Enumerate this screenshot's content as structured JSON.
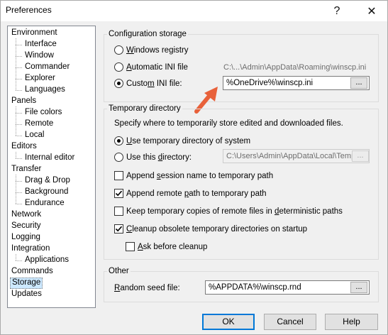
{
  "window": {
    "title": "Preferences",
    "help_glyph": "?",
    "close_glyph": "✕"
  },
  "tree": {
    "items": [
      {
        "label": "Environment",
        "level": 0
      },
      {
        "label": "Interface",
        "level": 1
      },
      {
        "label": "Window",
        "level": 1
      },
      {
        "label": "Commander",
        "level": 1
      },
      {
        "label": "Explorer",
        "level": 1
      },
      {
        "label": "Languages",
        "level": 1
      },
      {
        "label": "Panels",
        "level": 0
      },
      {
        "label": "File colors",
        "level": 1
      },
      {
        "label": "Remote",
        "level": 1
      },
      {
        "label": "Local",
        "level": 1
      },
      {
        "label": "Editors",
        "level": 0
      },
      {
        "label": "Internal editor",
        "level": 1
      },
      {
        "label": "Transfer",
        "level": 0
      },
      {
        "label": "Drag & Drop",
        "level": 1
      },
      {
        "label": "Background",
        "level": 1
      },
      {
        "label": "Endurance",
        "level": 1
      },
      {
        "label": "Network",
        "level": 0
      },
      {
        "label": "Security",
        "level": 0
      },
      {
        "label": "Logging",
        "level": 0
      },
      {
        "label": "Integration",
        "level": 0
      },
      {
        "label": "Applications",
        "level": 1
      },
      {
        "label": "Commands",
        "level": 0
      },
      {
        "label": "Storage",
        "level": 0,
        "selected": true
      },
      {
        "label": "Updates",
        "level": 0
      }
    ]
  },
  "config_storage": {
    "title": "Configuration storage",
    "windows_registry": {
      "pre": "",
      "ul": "W",
      "post": "indows registry",
      "selected": false
    },
    "automatic_ini": {
      "pre": "",
      "ul": "A",
      "post": "utomatic INI file",
      "selected": false
    },
    "automatic_ini_path": "C:\\...\\Admin\\AppData\\Roaming\\winscp.ini",
    "custom_ini": {
      "pre": "Custo",
      "ul": "m",
      "post": " INI file:",
      "selected": true
    },
    "custom_ini_value": "%OneDrive%\\winscp.ini",
    "browse_label": "..."
  },
  "temp_dir": {
    "title": "Temporary directory",
    "description": "Specify where to temporarily store edited and downloaded files.",
    "use_temp": {
      "pre": "",
      "ul": "U",
      "post": "se temporary directory of system",
      "selected": true
    },
    "use_this": {
      "pre": "Use this ",
      "ul": "d",
      "post": "irectory:",
      "selected": false
    },
    "this_dir_value": "C:\\Users\\Admin\\AppData\\Local\\Temp",
    "browse_label": "...",
    "append_session": {
      "pre": "Append ",
      "ul": "s",
      "post": "ession name to temporary path",
      "checked": false
    },
    "append_remote": {
      "pre": "Append remote ",
      "ul": "p",
      "post": "ath to temporary path",
      "checked": true
    },
    "keep_copies": {
      "pre": "Keep temporary copies of remote files in ",
      "ul": "d",
      "post": "eterministic paths",
      "checked": false
    },
    "cleanup": {
      "pre": "",
      "ul": "C",
      "post": "leanup obsolete temporary directories on startup",
      "checked": true
    },
    "ask_cleanup": {
      "pre": "",
      "ul": "A",
      "post": "sk before cleanup",
      "checked": false
    }
  },
  "other": {
    "title": "Other",
    "random_seed_label": {
      "pre": "",
      "ul": "R",
      "post": "andom seed file:"
    },
    "random_seed_value": "%APPDATA%\\winscp.rnd",
    "browse_label": "..."
  },
  "buttons": {
    "ok": "OK",
    "cancel": "Cancel",
    "help": "Help"
  },
  "colors": {
    "annotation_arrow": "#e8613a",
    "selection": "#cce8ff",
    "accent": "#0078d7"
  }
}
